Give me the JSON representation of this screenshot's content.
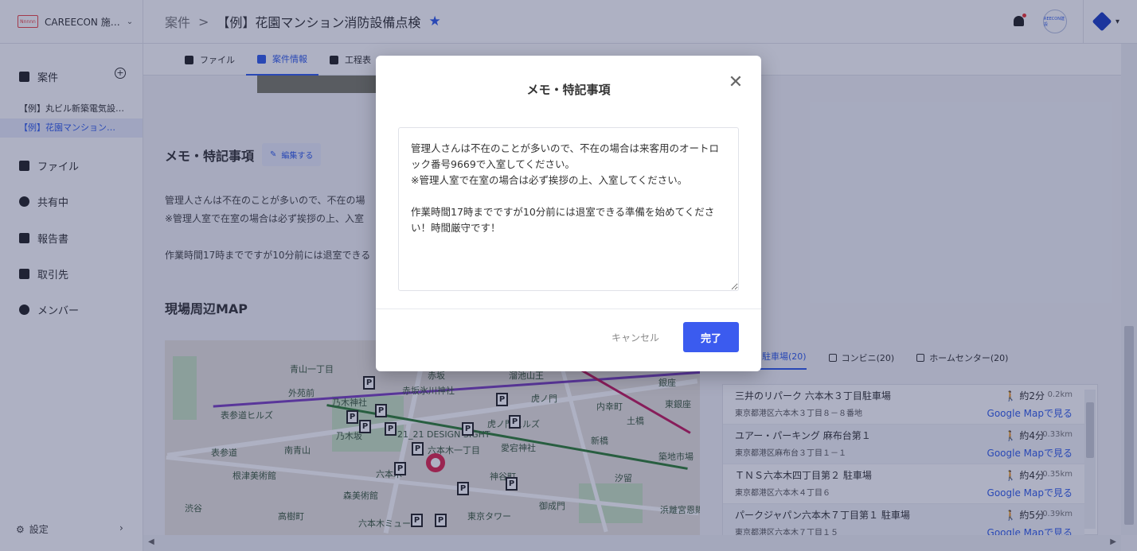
{
  "header": {
    "org_logo_text": "Nnnnn",
    "org_name": "CAREECON 施…",
    "breadcrumb_parent": "案件",
    "breadcrumb_sep": ">",
    "project_title": "【例】花園マンション消防設備点検",
    "star_glyph": "★",
    "avatar_text": "REECON建設"
  },
  "sidebar": {
    "projects_label": "案件",
    "project_items": [
      "【例】丸ビル新築電気設…",
      "【例】花園マンション…"
    ],
    "files_label": "ファイル",
    "shared_label": "共有中",
    "reports_label": "報告書",
    "clients_label": "取引先",
    "members_label": "メンバー",
    "settings_label": "設定"
  },
  "tabs": [
    {
      "label": "ファイル",
      "active": false
    },
    {
      "label": "案件情報",
      "active": true
    },
    {
      "label": "工程表",
      "active": false
    }
  ],
  "main": {
    "memo_title": "メモ・特記事項",
    "edit_label": "編集する",
    "memo_preview": [
      "管理人さんは不在のことが多いので、不在の場",
      "※管理人室で在室の場合は必ず挨拶の上、入室",
      "作業時間17時までですが10分前には退室できる"
    ],
    "map_title": "現場周辺MAP"
  },
  "map": {
    "labels": [
      "青山一丁目",
      "赤坂",
      "溜池山王",
      "外苑前",
      "乃木神社",
      "赤坂氷川神社",
      "虎ノ門",
      "内幸町",
      "銀座",
      "東銀座",
      "表参道ヒルズ",
      "乃木坂",
      "21_21 DESIGN SIGHT",
      "虎ノ門ヒルズ",
      "土橋",
      "南青山",
      "六本木一丁目",
      "愛宕神社",
      "新橋",
      "築地市場",
      "表参道",
      "根津美術館",
      "六本木",
      "神谷町",
      "汐留",
      "森美術館",
      "御成門",
      "浜離宮恩賜庭園",
      "渋谷",
      "高樹町",
      "東京タワー",
      "六本木ミュー"
    ],
    "pin_glyph": "P"
  },
  "nearby": {
    "tabs": [
      "駐車場(20)",
      "コンビニ(20)",
      "ホームセンター(20)"
    ],
    "items": [
      {
        "name": "三井のリパーク 六本木３丁目駐車場",
        "address": "東京都港区六本木３丁目８－８番地",
        "walk": "約2分",
        "distance": "0.2km",
        "map_link": "Google Mapで見る"
      },
      {
        "name": "ユアー・パーキング 麻布台第１",
        "address": "東京都港区麻布台３丁目１－１",
        "walk": "約4分",
        "distance": "0.33km",
        "map_link": "Google Mapで見る"
      },
      {
        "name": "ＴＮＳ六本木四丁目第２ 駐車場",
        "address": "東京都港区六本木４丁目６",
        "walk": "約4分",
        "distance": "0.35km",
        "map_link": "Google Mapで見る"
      },
      {
        "name": "パークジャパン六本木７丁目第１ 駐車場",
        "address": "東京都港区六本木７丁目１５",
        "walk": "約5分",
        "distance": "0.39km",
        "map_link": "Google Mapで見る"
      }
    ]
  },
  "modal": {
    "title": "メモ・特記事項",
    "close_glyph": "✕",
    "memo_text": "管理人さんは不在のことが多いので、不在の場合は来客用のオートロック番号9669で入室してください。\n※管理人室で在室の場合は必ず挨拶の上、入室してください。\n\n作業時間17時までですが10分前には退室できる準備を始めてください！時間厳守です！",
    "cancel_label": "キャンセル",
    "done_label": "完了"
  },
  "colors": {
    "accent": "#2f5bea",
    "primary_button": "#3b5bef",
    "pin": "#e0254d",
    "overlay": "rgba(30,40,90,0.36)"
  }
}
